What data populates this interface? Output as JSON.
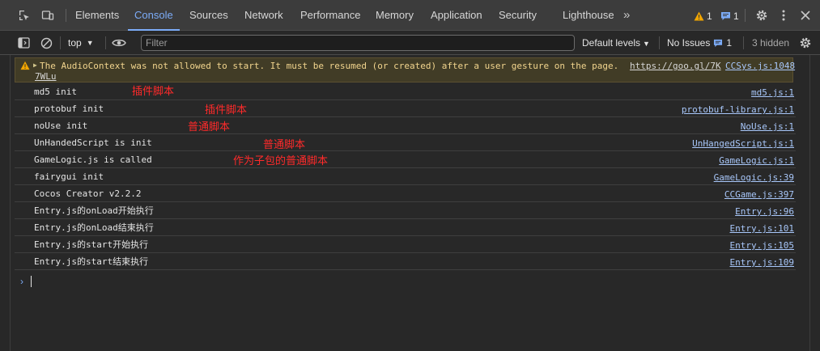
{
  "tabs": [
    {
      "label": "Elements"
    },
    {
      "label": "Console"
    },
    {
      "label": "Sources"
    },
    {
      "label": "Network"
    },
    {
      "label": "Performance"
    },
    {
      "label": "Memory"
    },
    {
      "label": "Application"
    },
    {
      "label": "Security"
    },
    {
      "label": "Lighthouse"
    }
  ],
  "active_tab": "Console",
  "more_tabs": "»",
  "badges": {
    "warnings": "1",
    "messages": "1"
  },
  "colors": {
    "accent": "#7cacf8",
    "warning": "#f2a600",
    "link": "#a8c7fa",
    "annotation": "#ff2a2a"
  },
  "toolbar": {
    "context": "top",
    "filter_placeholder": "Filter",
    "levels": "Default levels",
    "issues_label": "No Issues",
    "issues_count": "1",
    "hidden": "3 hidden"
  },
  "warning": {
    "message": "The AudioContext was not allowed to start. It must be resumed (or created) after a user gesture on the page.",
    "url_part1": "https://goo.gl/7K",
    "url_part2": "7WLu",
    "source": "CCSys.js:1048"
  },
  "logs": [
    {
      "text": "md5 init",
      "source": "md5.js:1"
    },
    {
      "text": "protobuf init",
      "source": "protobuf-library.js:1"
    },
    {
      "text": "noUse init",
      "source": "NoUse.js:1"
    },
    {
      "text": "UnHandedScript is init",
      "source": "UnHangedScript.js:1"
    },
    {
      "text": "GameLogic.js is called",
      "source": "GameLogic.js:1"
    },
    {
      "text": "fairygui init",
      "source": "GameLogic.js:39"
    },
    {
      "text": "Cocos Creator v2.2.2",
      "source": "CCGame.js:397"
    },
    {
      "text": "Entry.js的onLoad开始执行",
      "source": "Entry.js:96"
    },
    {
      "text": "Entry.js的onLoad结束执行",
      "source": "Entry.js:101"
    },
    {
      "text": "Entry.js的start开始执行",
      "source": "Entry.js:105"
    },
    {
      "text": "Entry.js的start结束执行",
      "source": "Entry.js:109"
    }
  ],
  "annotations": [
    {
      "text": "插件脚本"
    },
    {
      "text": "插件脚本"
    },
    {
      "text": "普通脚本"
    },
    {
      "text": "普通脚本"
    },
    {
      "text": "作为子包的普通脚本"
    }
  ],
  "prompt": "›"
}
